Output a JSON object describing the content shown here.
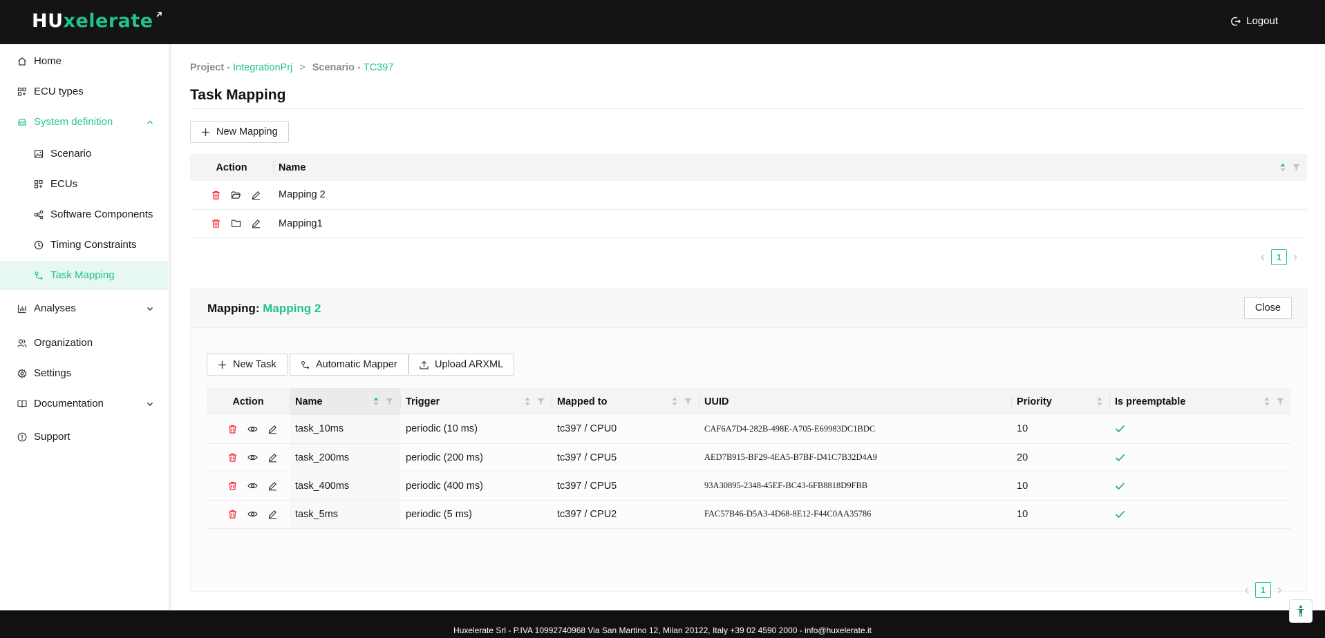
{
  "app": {
    "logo_prefix": "HU",
    "logo_suffix": "xelerate",
    "logout_label": "Logout"
  },
  "colors": {
    "accent": "#23c38a",
    "danger": "#f5222d",
    "topbar": "#141414"
  },
  "sidebar": {
    "items": [
      {
        "label": "Home",
        "icon": "home-icon"
      },
      {
        "label": "ECU types",
        "icon": "grid-icon"
      },
      {
        "label": "System definition",
        "icon": "car-icon"
      },
      {
        "label": "Scenario",
        "icon": "picture-icon"
      },
      {
        "label": "ECUs",
        "icon": "grid-icon"
      },
      {
        "label": "Software Components",
        "icon": "nodes-icon"
      },
      {
        "label": "Timing Constraints",
        "icon": "clock-icon"
      },
      {
        "label": "Task Mapping",
        "icon": "mapping-icon"
      },
      {
        "label": "Analyses",
        "icon": "bar-chart-icon"
      },
      {
        "label": "Organization",
        "icon": "users-icon"
      },
      {
        "label": "Settings",
        "icon": "gear-icon"
      },
      {
        "label": "Documentation",
        "icon": "book-icon"
      },
      {
        "label": "Support",
        "icon": "info-icon"
      }
    ]
  },
  "breadcrumb": {
    "project_label": "Project - ",
    "project_name": "IntegrationPrj",
    "separator": ">",
    "scenario_label": "Scenario - ",
    "scenario_name": "TC397"
  },
  "page": {
    "title": "Task Mapping",
    "new_mapping_label": "New Mapping"
  },
  "mappings_table": {
    "headers": {
      "action": "Action",
      "name": "Name"
    },
    "rows": [
      {
        "name": "Mapping 2"
      },
      {
        "name": "Mapping1"
      }
    ],
    "page": "1"
  },
  "mapping_panel": {
    "title_prefix": "Mapping: ",
    "title_name": "Mapping 2",
    "close_label": "Close",
    "buttons": {
      "new_task": "New Task",
      "automatic_mapper": "Automatic Mapper",
      "upload_arxml": "Upload ARXML"
    },
    "headers": {
      "action": "Action",
      "name": "Name",
      "trigger": "Trigger",
      "mapped_to": "Mapped to",
      "uuid": "UUID",
      "priority": "Priority",
      "is_preemptable": "Is preemptable"
    },
    "rows": [
      {
        "name": "task_10ms",
        "trigger": "periodic (10 ms)",
        "mapped_to": "tc397 / CPU0",
        "uuid": "CAF6A7D4-282B-498E-A705-E69983DC1BDC",
        "priority": "10",
        "preemptable": true
      },
      {
        "name": "task_200ms",
        "trigger": "periodic (200 ms)",
        "mapped_to": "tc397 / CPU5",
        "uuid": "AED7B915-BF29-4EA5-B7BF-D41C7B32D4A9",
        "priority": "20",
        "preemptable": true
      },
      {
        "name": "task_400ms",
        "trigger": "periodic (400 ms)",
        "mapped_to": "tc397 / CPU5",
        "uuid": "93A30895-2348-45EF-BC43-6FB8818D9FBB",
        "priority": "10",
        "preemptable": true
      },
      {
        "name": "task_5ms",
        "trigger": "periodic (5 ms)",
        "mapped_to": "tc397 / CPU2",
        "uuid": "FAC57B46-D5A3-4D68-8E12-F44C0AA35786",
        "priority": "10",
        "preemptable": true
      }
    ],
    "page": "1"
  },
  "footer": {
    "text": "Huxelerate Srl - P.IVA 10992740968   Via San Martino 12, Milan 20122, Italy   +39 02 4590 2000 - info@huxelerate.it"
  }
}
